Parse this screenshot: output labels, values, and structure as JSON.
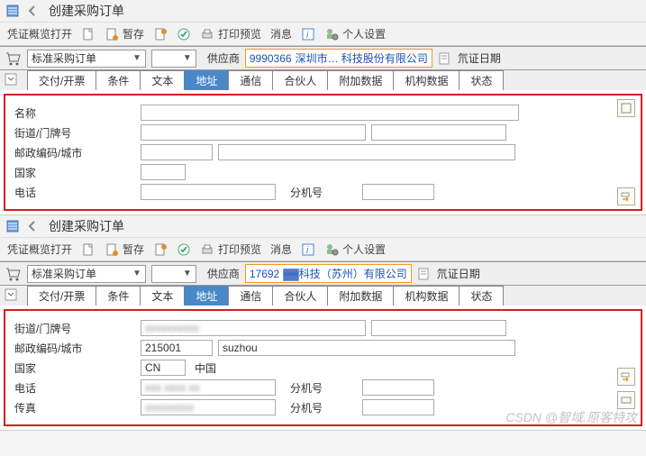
{
  "top": {
    "title": "创建采购订单",
    "toolbar": {
      "voucher": "凭证概览打开",
      "save": "暂存",
      "preview": "打印预览",
      "message": "消息",
      "personal": "个人设置"
    },
    "orderType": "标准采购订单",
    "supplierLabel": "供应商",
    "supplierCode": "9990366",
    "supplierName": "深圳市… 科技股份有限公司",
    "docDate": "氘证日期",
    "tabs": {
      "delivery": "交付/开票",
      "condition": "条件",
      "text": "文本",
      "address": "地址",
      "comm": "通信",
      "partner": "合伙人",
      "extra": "附加数据",
      "org": "机构数据",
      "status": "状态"
    },
    "fields": {
      "name": "名称",
      "street": "街道/门牌号",
      "postal": "邮政编码/城市",
      "country": "国家",
      "phone": "电话",
      "ext": "分机号"
    }
  },
  "bottom": {
    "title": "创建采购订单",
    "toolbar": {
      "voucher": "凭证概览打开",
      "save": "暂存",
      "preview": "打印预览",
      "message": "消息",
      "personal": "个人设置"
    },
    "orderType": "标准采购订单",
    "supplierLabel": "供应商",
    "supplierCode": "17692",
    "supplierName": "▓▓科技（苏州）有限公司",
    "docDate": "氘证日期",
    "tabs": {
      "delivery": "交付/开票",
      "condition": "条件",
      "text": "文本",
      "address": "地址",
      "comm": "通信",
      "partner": "合伙人",
      "extra": "附加数据",
      "org": "机构数据",
      "status": "状态"
    },
    "fields": {
      "street": "街道/门牌号",
      "postal": "邮政编码/城市",
      "postalVal": "215001",
      "cityVal": "suzhou",
      "country": "国家",
      "countryCode": "CN",
      "countryName": "中国",
      "phone": "电话",
      "ext": "分机号",
      "fax": "传真"
    }
  },
  "watermark": "CSDN @智域.原客特攻"
}
